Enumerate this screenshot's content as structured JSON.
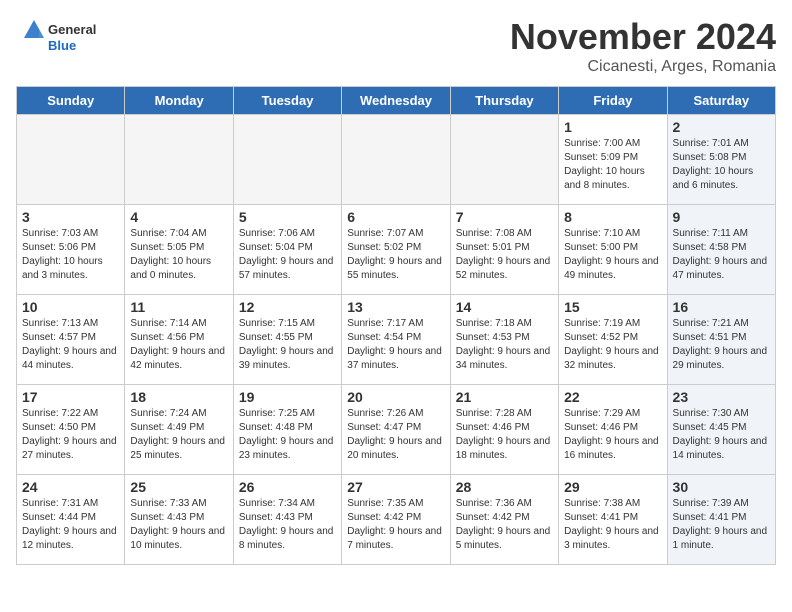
{
  "header": {
    "logo_general": "General",
    "logo_blue": "Blue",
    "title": "November 2024",
    "subtitle": "Cicanesti, Arges, Romania"
  },
  "weekdays": [
    "Sunday",
    "Monday",
    "Tuesday",
    "Wednesday",
    "Thursday",
    "Friday",
    "Saturday"
  ],
  "weeks": [
    [
      {
        "day": "",
        "info": "",
        "empty": true
      },
      {
        "day": "",
        "info": "",
        "empty": true
      },
      {
        "day": "",
        "info": "",
        "empty": true
      },
      {
        "day": "",
        "info": "",
        "empty": true
      },
      {
        "day": "",
        "info": "",
        "empty": true
      },
      {
        "day": "1",
        "info": "Sunrise: 7:00 AM\nSunset: 5:09 PM\nDaylight: 10 hours and 8 minutes.",
        "empty": false,
        "shaded": false
      },
      {
        "day": "2",
        "info": "Sunrise: 7:01 AM\nSunset: 5:08 PM\nDaylight: 10 hours and 6 minutes.",
        "empty": false,
        "shaded": true
      }
    ],
    [
      {
        "day": "3",
        "info": "Sunrise: 7:03 AM\nSunset: 5:06 PM\nDaylight: 10 hours and 3 minutes.",
        "empty": false,
        "shaded": false
      },
      {
        "day": "4",
        "info": "Sunrise: 7:04 AM\nSunset: 5:05 PM\nDaylight: 10 hours and 0 minutes.",
        "empty": false,
        "shaded": false
      },
      {
        "day": "5",
        "info": "Sunrise: 7:06 AM\nSunset: 5:04 PM\nDaylight: 9 hours and 57 minutes.",
        "empty": false,
        "shaded": false
      },
      {
        "day": "6",
        "info": "Sunrise: 7:07 AM\nSunset: 5:02 PM\nDaylight: 9 hours and 55 minutes.",
        "empty": false,
        "shaded": false
      },
      {
        "day": "7",
        "info": "Sunrise: 7:08 AM\nSunset: 5:01 PM\nDaylight: 9 hours and 52 minutes.",
        "empty": false,
        "shaded": false
      },
      {
        "day": "8",
        "info": "Sunrise: 7:10 AM\nSunset: 5:00 PM\nDaylight: 9 hours and 49 minutes.",
        "empty": false,
        "shaded": false
      },
      {
        "day": "9",
        "info": "Sunrise: 7:11 AM\nSunset: 4:58 PM\nDaylight: 9 hours and 47 minutes.",
        "empty": false,
        "shaded": true
      }
    ],
    [
      {
        "day": "10",
        "info": "Sunrise: 7:13 AM\nSunset: 4:57 PM\nDaylight: 9 hours and 44 minutes.",
        "empty": false,
        "shaded": false
      },
      {
        "day": "11",
        "info": "Sunrise: 7:14 AM\nSunset: 4:56 PM\nDaylight: 9 hours and 42 minutes.",
        "empty": false,
        "shaded": false
      },
      {
        "day": "12",
        "info": "Sunrise: 7:15 AM\nSunset: 4:55 PM\nDaylight: 9 hours and 39 minutes.",
        "empty": false,
        "shaded": false
      },
      {
        "day": "13",
        "info": "Sunrise: 7:17 AM\nSunset: 4:54 PM\nDaylight: 9 hours and 37 minutes.",
        "empty": false,
        "shaded": false
      },
      {
        "day": "14",
        "info": "Sunrise: 7:18 AM\nSunset: 4:53 PM\nDaylight: 9 hours and 34 minutes.",
        "empty": false,
        "shaded": false
      },
      {
        "day": "15",
        "info": "Sunrise: 7:19 AM\nSunset: 4:52 PM\nDaylight: 9 hours and 32 minutes.",
        "empty": false,
        "shaded": false
      },
      {
        "day": "16",
        "info": "Sunrise: 7:21 AM\nSunset: 4:51 PM\nDaylight: 9 hours and 29 minutes.",
        "empty": false,
        "shaded": true
      }
    ],
    [
      {
        "day": "17",
        "info": "Sunrise: 7:22 AM\nSunset: 4:50 PM\nDaylight: 9 hours and 27 minutes.",
        "empty": false,
        "shaded": false
      },
      {
        "day": "18",
        "info": "Sunrise: 7:24 AM\nSunset: 4:49 PM\nDaylight: 9 hours and 25 minutes.",
        "empty": false,
        "shaded": false
      },
      {
        "day": "19",
        "info": "Sunrise: 7:25 AM\nSunset: 4:48 PM\nDaylight: 9 hours and 23 minutes.",
        "empty": false,
        "shaded": false
      },
      {
        "day": "20",
        "info": "Sunrise: 7:26 AM\nSunset: 4:47 PM\nDaylight: 9 hours and 20 minutes.",
        "empty": false,
        "shaded": false
      },
      {
        "day": "21",
        "info": "Sunrise: 7:28 AM\nSunset: 4:46 PM\nDaylight: 9 hours and 18 minutes.",
        "empty": false,
        "shaded": false
      },
      {
        "day": "22",
        "info": "Sunrise: 7:29 AM\nSunset: 4:46 PM\nDaylight: 9 hours and 16 minutes.",
        "empty": false,
        "shaded": false
      },
      {
        "day": "23",
        "info": "Sunrise: 7:30 AM\nSunset: 4:45 PM\nDaylight: 9 hours and 14 minutes.",
        "empty": false,
        "shaded": true
      }
    ],
    [
      {
        "day": "24",
        "info": "Sunrise: 7:31 AM\nSunset: 4:44 PM\nDaylight: 9 hours and 12 minutes.",
        "empty": false,
        "shaded": false
      },
      {
        "day": "25",
        "info": "Sunrise: 7:33 AM\nSunset: 4:43 PM\nDaylight: 9 hours and 10 minutes.",
        "empty": false,
        "shaded": false
      },
      {
        "day": "26",
        "info": "Sunrise: 7:34 AM\nSunset: 4:43 PM\nDaylight: 9 hours and 8 minutes.",
        "empty": false,
        "shaded": false
      },
      {
        "day": "27",
        "info": "Sunrise: 7:35 AM\nSunset: 4:42 PM\nDaylight: 9 hours and 7 minutes.",
        "empty": false,
        "shaded": false
      },
      {
        "day": "28",
        "info": "Sunrise: 7:36 AM\nSunset: 4:42 PM\nDaylight: 9 hours and 5 minutes.",
        "empty": false,
        "shaded": false
      },
      {
        "day": "29",
        "info": "Sunrise: 7:38 AM\nSunset: 4:41 PM\nDaylight: 9 hours and 3 minutes.",
        "empty": false,
        "shaded": false
      },
      {
        "day": "30",
        "info": "Sunrise: 7:39 AM\nSunset: 4:41 PM\nDaylight: 9 hours and 1 minute.",
        "empty": false,
        "shaded": true
      }
    ]
  ]
}
